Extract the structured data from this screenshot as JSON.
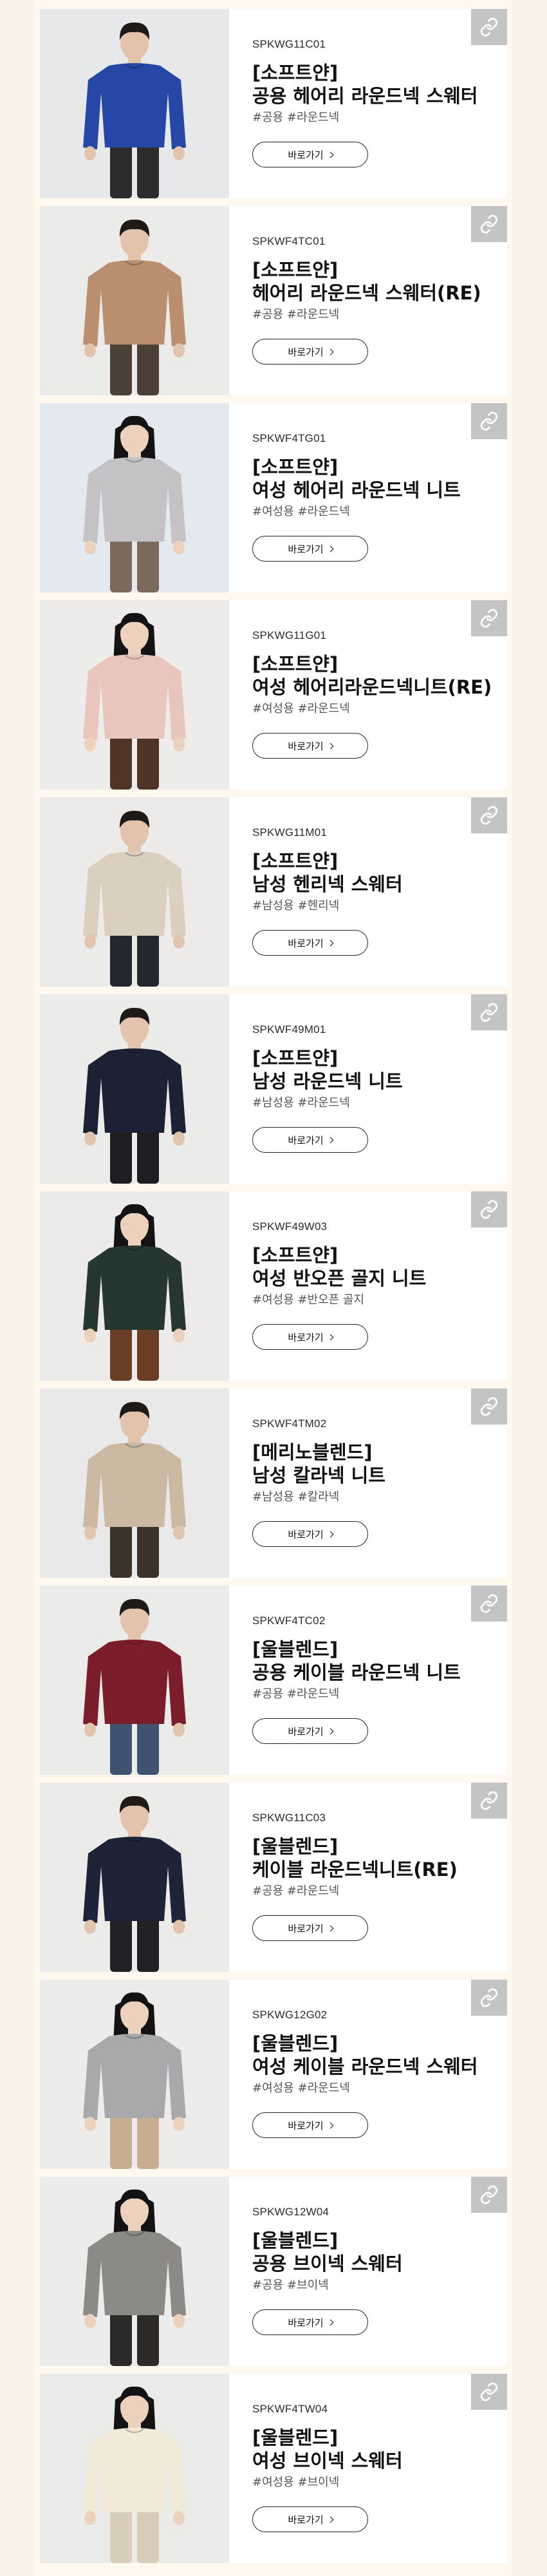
{
  "ui": {
    "go_label": "바로가기",
    "link_icon": "link-icon",
    "link_icon_color": "#c4c4c4",
    "background": "#fbf3e7"
  },
  "products": [
    {
      "code": "SPKWG11C01",
      "category": "[소프트얀]",
      "name": "공용 헤어리 라운드넥 스웨터",
      "tags": "#공용 #라운드넥",
      "sweater": "#2747a6",
      "pants": "#2d2b2c",
      "bg": "#e7e8ea",
      "skin": "#e2c4ad",
      "hair": "#1f1a18",
      "long_hair": false
    },
    {
      "code": "SPKWF4TC01",
      "category": "[소프트얀]",
      "name": "헤어리 라운드넥 스웨터(RE)",
      "tags": "#공용 #라운드넥",
      "sweater": "#b98f70",
      "pants": "#4a4036",
      "bg": "#ebebea",
      "skin": "#e2c4ad",
      "hair": "#1f1a18",
      "long_hair": false
    },
    {
      "code": "SPKWF4TG01",
      "category": "[소프트얀]",
      "name": "여성 헤어리 라운드넥 니트",
      "tags": "#여성용 #라운드넥",
      "sweater": "#c4c2c4",
      "pants": "#7b6a5c",
      "bg": "#e4e9f0",
      "skin": "#ecd1bd",
      "hair": "#141212",
      "long_hair": true
    },
    {
      "code": "SPKWG11G01",
      "category": "[소프트얀]",
      "name": "여성 헤어리라운드넥니트(RE)",
      "tags": "#여성용 #라운드넥",
      "sweater": "#e9c6bd",
      "pants": "#4f3526",
      "bg": "#eeeceb",
      "skin": "#ecd1bd",
      "hair": "#141212",
      "long_hair": true
    },
    {
      "code": "SPKWG11M01",
      "category": "[소프트얀]",
      "name": "남성 헨리넥 스웨터",
      "tags": "#남성용 #헨리넥",
      "sweater": "#dbcfbf",
      "pants": "#24272d",
      "bg": "#ecebe9",
      "skin": "#e2c4ad",
      "hair": "#1f1a18",
      "long_hair": false
    },
    {
      "code": "SPKWF49M01",
      "category": "[소프트얀]",
      "name": "남성 라운드넥 니트",
      "tags": "#남성용 #라운드넥",
      "sweater": "#1c2233",
      "pants": "#1e1e22",
      "bg": "#ebebea",
      "skin": "#e2c4ad",
      "hair": "#1f1a18",
      "long_hair": false
    },
    {
      "code": "SPKWF49W03",
      "category": "[소프트얀]",
      "name": "여성 반오픈 골지 니트",
      "tags": "#여성용 #반오픈 골지",
      "sweater": "#26372f",
      "pants": "#6a3e24",
      "bg": "#ecebe9",
      "skin": "#ecd1bd",
      "hair": "#141212",
      "long_hair": true
    },
    {
      "code": "SPKWF4TM02",
      "category": "[메리노블렌드]",
      "name": "남성 칼라넥 니트",
      "tags": "#남성용 #칼라넥",
      "sweater": "#cbb9a4",
      "pants": "#3b3329",
      "bg": "#e9e9ea",
      "skin": "#e2c4ad",
      "hair": "#1f1a18",
      "long_hair": false
    },
    {
      "code": "SPKWF4TC02",
      "category": "[울블렌드]",
      "name": "공용 케이블 라운드넥 니트",
      "tags": "#공용 #라운드넥",
      "sweater": "#7c1d2b",
      "pants": "#3f5371",
      "bg": "#ebebea",
      "skin": "#e2c4ad",
      "hair": "#1f1a18",
      "long_hair": false
    },
    {
      "code": "SPKWG11C03",
      "category": "[울블렌드]",
      "name": "케이블 라운드넥니트(RE)",
      "tags": "#공용 #라운드넥",
      "sweater": "#1d2438",
      "pants": "#222226",
      "bg": "#ebebea",
      "skin": "#e2c4ad",
      "hair": "#1f1a18",
      "long_hair": false
    },
    {
      "code": "SPKWG12G02",
      "category": "[울블렌드]",
      "name": "여성 케이블 라운드넥 스웨터",
      "tags": "#여성용 #라운드넥",
      "sweater": "#a9a9ab",
      "pants": "#c8ae90",
      "bg": "#eeecea",
      "skin": "#ecd1bd",
      "hair": "#141212",
      "long_hair": true
    },
    {
      "code": "SPKWG12W04",
      "category": "[울블렌드]",
      "name": "공용 브이넥 스웨터",
      "tags": "#공용 #브이넥",
      "sweater": "#8b8a86",
      "pants": "#2c2b2a",
      "bg": "#ececec",
      "skin": "#ecd1bd",
      "hair": "#141212",
      "long_hair": true
    },
    {
      "code": "SPKWF4TW04",
      "category": "[울블렌드]",
      "name": "여성 브이넥 스웨터",
      "tags": "#여성용 #브이넥",
      "sweater": "#f1ead8",
      "pants": "#d8cdb9",
      "bg": "#ebebea",
      "skin": "#ecd1bd",
      "hair": "#141212",
      "long_hair": true
    }
  ]
}
